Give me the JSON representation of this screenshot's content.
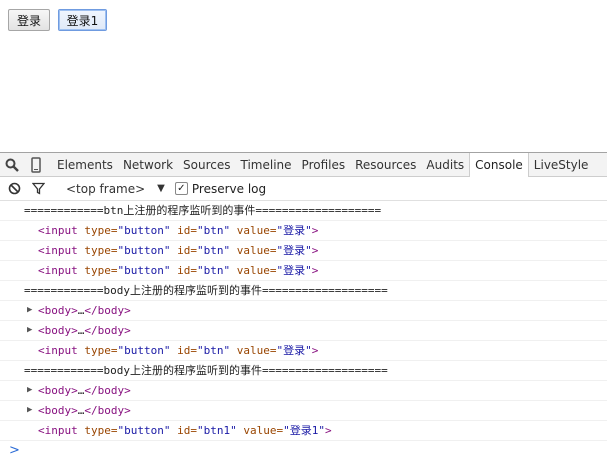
{
  "page": {
    "buttons": [
      {
        "label": "登录"
      },
      {
        "label": "登录1"
      }
    ]
  },
  "devtools": {
    "tabs": [
      "Elements",
      "Network",
      "Sources",
      "Timeline",
      "Profiles",
      "Resources",
      "Audits",
      "Console",
      "LiveStyle"
    ],
    "active_tab": "Console",
    "toolbar": {
      "frame": "<top frame>",
      "preserve_log": "Preserve log",
      "preserve_log_checked": true
    },
    "console": {
      "messages": [
        {
          "type": "text",
          "text": "============btn上注册的程序监听到的事件==================="
        },
        {
          "type": "input",
          "tag_open": "<input",
          "a1": "type=",
          "v1": "\"button\"",
          "a2": "id=",
          "v2": "\"btn\"",
          "a3": "value=",
          "v3": "\"登录\"",
          "tag_close": ">"
        },
        {
          "type": "input",
          "tag_open": "<input",
          "a1": "type=",
          "v1": "\"button\"",
          "a2": "id=",
          "v2": "\"btn\"",
          "a3": "value=",
          "v3": "\"登录\"",
          "tag_close": ">"
        },
        {
          "type": "input",
          "tag_open": "<input",
          "a1": "type=",
          "v1": "\"button\"",
          "a2": "id=",
          "v2": "\"btn\"",
          "a3": "value=",
          "v3": "\"登录\"",
          "tag_close": ">"
        },
        {
          "type": "text",
          "text": "============body上注册的程序监听到的事件==================="
        },
        {
          "type": "body",
          "open": "<body>",
          "ellipsis": "…",
          "close": "</body>"
        },
        {
          "type": "body",
          "open": "<body>",
          "ellipsis": "…",
          "close": "</body>"
        },
        {
          "type": "input",
          "tag_open": "<input",
          "a1": "type=",
          "v1": "\"button\"",
          "a2": "id=",
          "v2": "\"btn\"",
          "a3": "value=",
          "v3": "\"登录\"",
          "tag_close": ">"
        },
        {
          "type": "text",
          "text": "============body上注册的程序监听到的事件==================="
        },
        {
          "type": "body",
          "open": "<body>",
          "ellipsis": "…",
          "close": "</body>"
        },
        {
          "type": "body",
          "open": "<body>",
          "ellipsis": "…",
          "close": "</body>"
        },
        {
          "type": "input",
          "tag_open": "<input",
          "a1": "type=",
          "v1": "\"button\"",
          "a2": "id=",
          "v2": "\"btn1\"",
          "a3": "value=",
          "v3": "\"登录1\"",
          "tag_close": ">"
        }
      ],
      "prompt": ">"
    }
  }
}
